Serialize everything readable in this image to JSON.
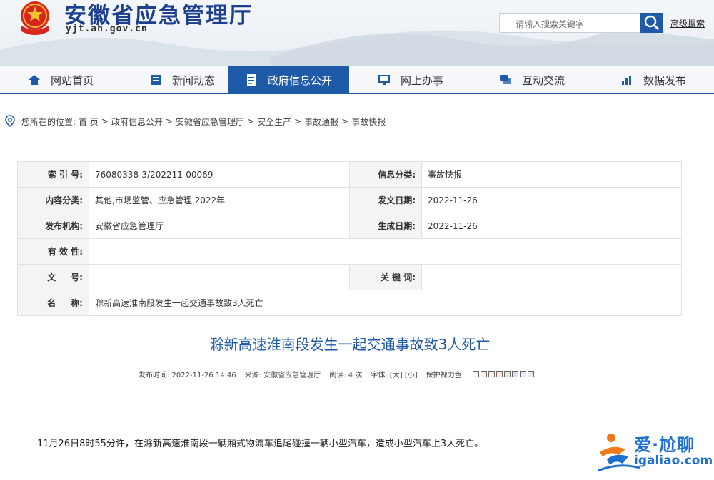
{
  "header": {
    "site_title": "安徽省应急管理厅",
    "site_domain": "yjt.ah.gov.cn",
    "search_placeholder": "请输入搜索关键字",
    "advanced_search": "高级搜索"
  },
  "nav": {
    "items": [
      {
        "label": "网站首页",
        "icon": "home-icon"
      },
      {
        "label": "新闻动态",
        "icon": "news-icon"
      },
      {
        "label": "政府信息公开",
        "icon": "document-icon",
        "active": true
      },
      {
        "label": "网上办事",
        "icon": "monitor-icon"
      },
      {
        "label": "互动交流",
        "icon": "chat-icon"
      },
      {
        "label": "数据发布",
        "icon": "chart-icon"
      }
    ],
    "active_color": "#1f5aa8"
  },
  "breadcrumb": {
    "prefix": "您所在的位置:",
    "items": [
      "首 页",
      "政府信息公开",
      "安徽省应急管理厅",
      "安全生产",
      "事故通报",
      "事故快报"
    ],
    "separator": ">"
  },
  "info_table": {
    "index_label": "索 引 号:",
    "index_value": "76080338-3/202211-00069",
    "category_label": "信息分类:",
    "category_value": "事故快报",
    "content_label": "内容分类:",
    "content_value": "其他,市场监管、应急管理,2022年",
    "date_label": "发文日期:",
    "date_value": "2022-11-26",
    "org_label": "发布机构:",
    "org_value": "安徽省应急管理厅",
    "gen_label": "生成日期:",
    "gen_value": "2022-11-26",
    "validity_label": "有 效 性:",
    "validity_value": "",
    "docno_label": "文     号:",
    "docno_value": "",
    "keyword_label": "关 键 词:",
    "keyword_value": "",
    "name_label": "名     称:",
    "name_value": "滁新高速淮南段发生一起交通事故致3人死亡"
  },
  "article": {
    "title": "滁新高速淮南段发生一起交通事故致3人死亡",
    "publish_time": "发布时间: 2022-11-26 14:46",
    "source": "来源: 安徽省应急管理厅",
    "reads": "阅读: 4 次",
    "font_size": "字体: [大] [小]",
    "eye_care": "保护视力色:",
    "body": "11月26日8时55分许，在滁新高速淮南段一辆厢式物流车追尾碰撞一辆小型汽车，造成小型汽车上3人死亡。"
  },
  "watermark": {
    "cn": "爱·尬聊",
    "url": "igaliao.com"
  }
}
